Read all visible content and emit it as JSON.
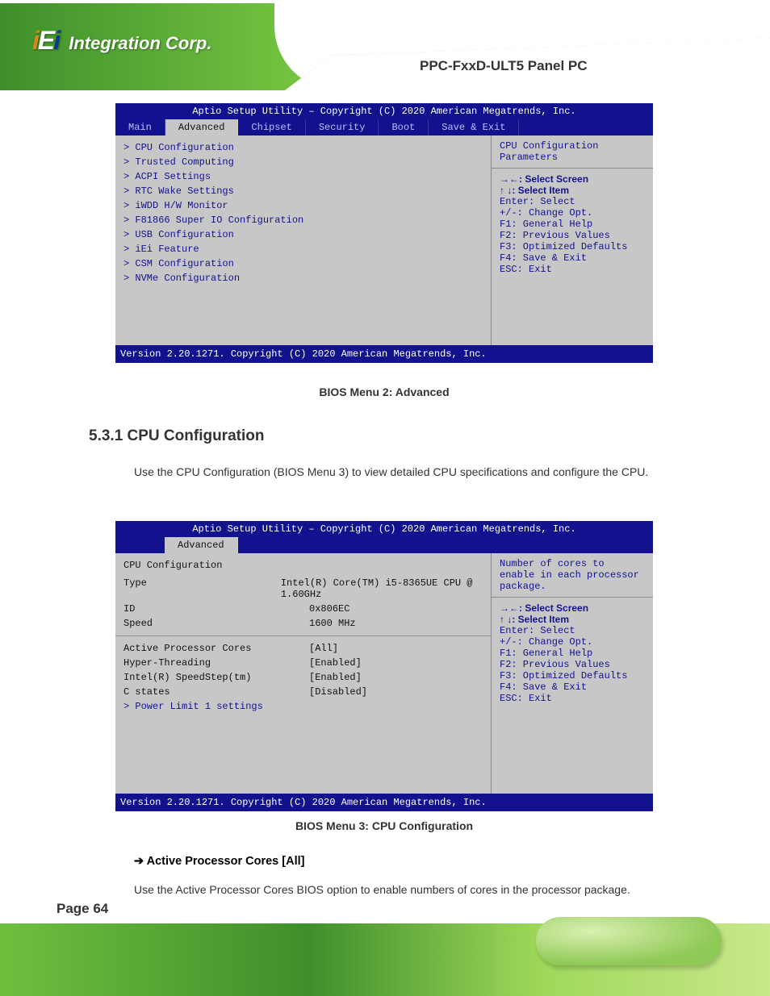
{
  "product_title": "PPC-FxxD-ULT5 Panel PC",
  "page_number": "Page 64",
  "bios1": {
    "title": "Aptio Setup Utility – Copyright (C) 2020 American Megatrends, Inc.",
    "tabs": [
      "Main",
      "Advanced",
      "Chipset",
      "Security",
      "Boot",
      "Save & Exit"
    ],
    "active_tab_index": 1,
    "items": [
      "> CPU Configuration",
      "> Trusted Computing",
      "> ACPI Settings",
      "> RTC Wake Settings",
      "> iWDD H/W Monitor",
      "> F81866 Super IO Configuration",
      "> USB Configuration",
      "> iEi Feature",
      "> CSM Configuration",
      "> NVMe Configuration"
    ],
    "right_hint": "CPU Configuration Parameters",
    "keybinds": [
      "→←: Select Screen",
      "↑ ↓: Select Item",
      "Enter: Select",
      "+/-: Change Opt.",
      "F1: General Help",
      "F2: Previous Values",
      "F3: Optimized Defaults",
      "F4: Save & Exit",
      "ESC: Exit"
    ],
    "footer": "Version 2.20.1271. Copyright (C) 2020 American Megatrends, Inc."
  },
  "caption1": "BIOS Menu 2: Advanced",
  "section": "5.3.1 CPU Configuration",
  "section_para": "Use the CPU Configuration (BIOS Menu 3) to view detailed CPU specifications and configure the CPU.",
  "bios2": {
    "title": "Aptio Setup Utility – Copyright (C) 2020 American Megatrends, Inc.",
    "tabs": [
      "Advanced"
    ],
    "active_tab_index": 0,
    "rows": [
      {
        "k": "CPU Configuration",
        "v": ""
      },
      {
        "k": "",
        "v": ""
      },
      {
        "k": "Type",
        "v": "Intel(R) Core(TM) i5-8365UE CPU @ 1.60GHz"
      },
      {
        "k": "ID",
        "v": "0x806EC"
      },
      {
        "k": "Speed",
        "v": "1600 MHz"
      }
    ],
    "hr_then": [
      {
        "k": "Active Processor Cores",
        "v": "[All]"
      },
      {
        "k": "Hyper-Threading",
        "v": "[Enabled]"
      },
      {
        "k": "Intel(R) SpeedStep(tm)",
        "v": "[Enabled]"
      },
      {
        "k": "C states",
        "v": "[Disabled]"
      }
    ],
    "sub_link": "> Power Limit 1 settings",
    "right_hint": "Number of cores to enable in each processor package.",
    "keybinds": [
      "→←: Select Screen",
      "↑ ↓: Select Item",
      "Enter: Select",
      "+/-: Change Opt.",
      "F1: General Help",
      "F2: Previous Values",
      "F3: Optimized Defaults",
      "F4: Save & Exit",
      "ESC: Exit"
    ],
    "footer": "Version 2.20.1271. Copyright (C) 2020 American Megatrends, Inc."
  },
  "caption2": "BIOS Menu 3: CPU Configuration",
  "option_head": "➔ Active Processor Cores [All]",
  "option_para": "Use the Active Processor Cores BIOS option to enable numbers of cores in the processor package."
}
